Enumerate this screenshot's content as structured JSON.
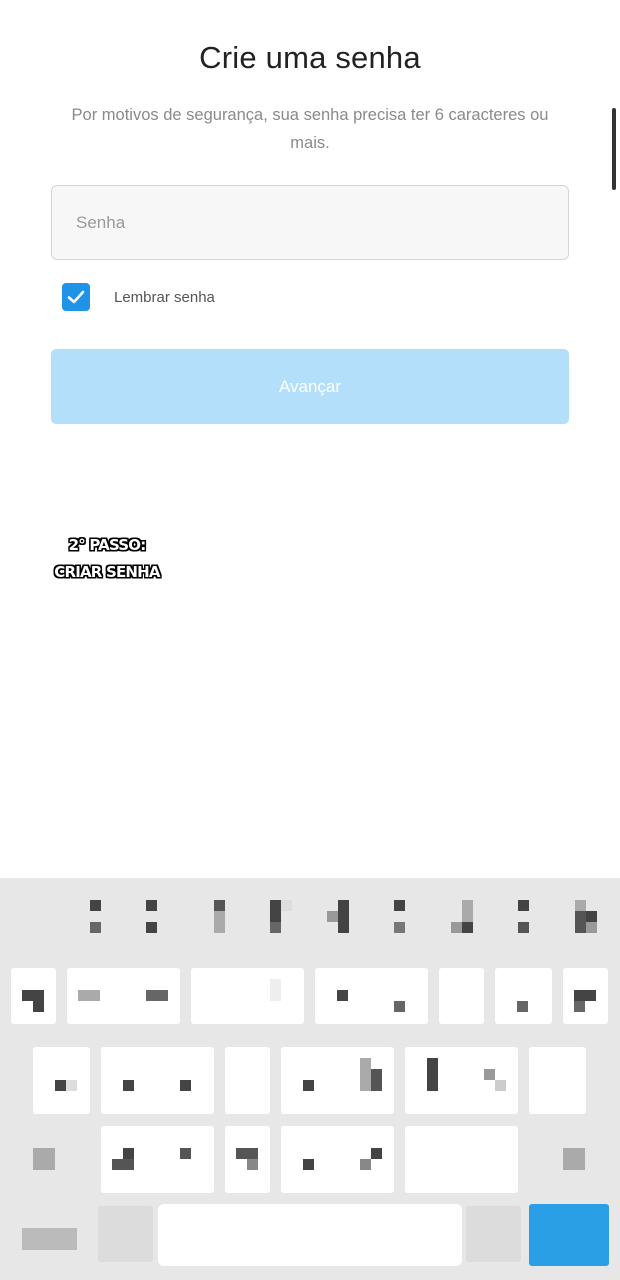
{
  "header": {
    "title": "Crie uma senha",
    "subtitle": "Por motivos de segurança, sua senha precisa ter 6 caracteres ou mais."
  },
  "form": {
    "password_placeholder": "Senha",
    "password_value": "",
    "remember_checked": true,
    "remember_label": "Lembrar senha",
    "next_label": "Avançar"
  },
  "annotation": {
    "line1": "2° PASSO:",
    "line2": "CRIAR SENHA"
  },
  "keyboard": {
    "state": "pixelated/obscured",
    "accent_color": "#2a9fe6"
  },
  "colors": {
    "primary": "#1e93e8",
    "button_disabled": "#b3dffb",
    "title": "#222222",
    "subtitle": "#8a8a8a"
  }
}
